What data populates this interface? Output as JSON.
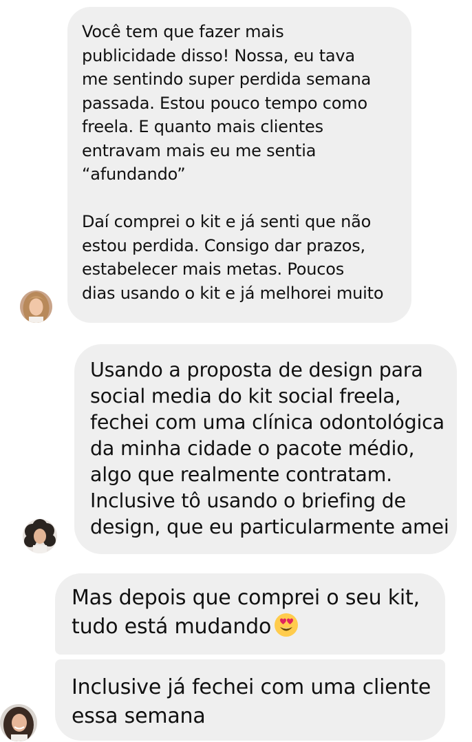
{
  "messages": [
    {
      "text": "Você tem que fazer mais\npublicidade disso! Nossa, eu tava\nme sentindo super perdida semana\npassada. Estou pouco tempo como\nfreela. E quanto mais clientes\nentravam mais eu me sentia\n“afundando”\n\nDaí comprei o kit e já senti que não\nestou perdida. Consigo dar prazos,\nestabelecer mais metas. Poucos\ndias usando o kit e já melhorei muito",
      "avatar": "avatar-woman-blonde"
    },
    {
      "text": "Usando a proposta de design para\nsocial media do kit social freela,\nfechei com uma clínica odontológica\nda minha cidade o pacote médio,\nalgo que realmente contratam.\nInclusive tô usando o briefing de\ndesign, que eu particularmente amei",
      "avatar": "avatar-woman-curly-hair"
    },
    {
      "text": "Mas depois que comprei o seu kit,\ntudo está mudando",
      "emoji": "heart-eyes-emoji"
    },
    {
      "text": "Inclusive já fechei com uma cliente\nessa semana",
      "avatar": "avatar-woman-dark-hair"
    }
  ],
  "colors": {
    "bubble": "#efefef",
    "text": "#111111",
    "emoji_face": "#ffcc4d",
    "emoji_hearts": "#e0245e"
  }
}
